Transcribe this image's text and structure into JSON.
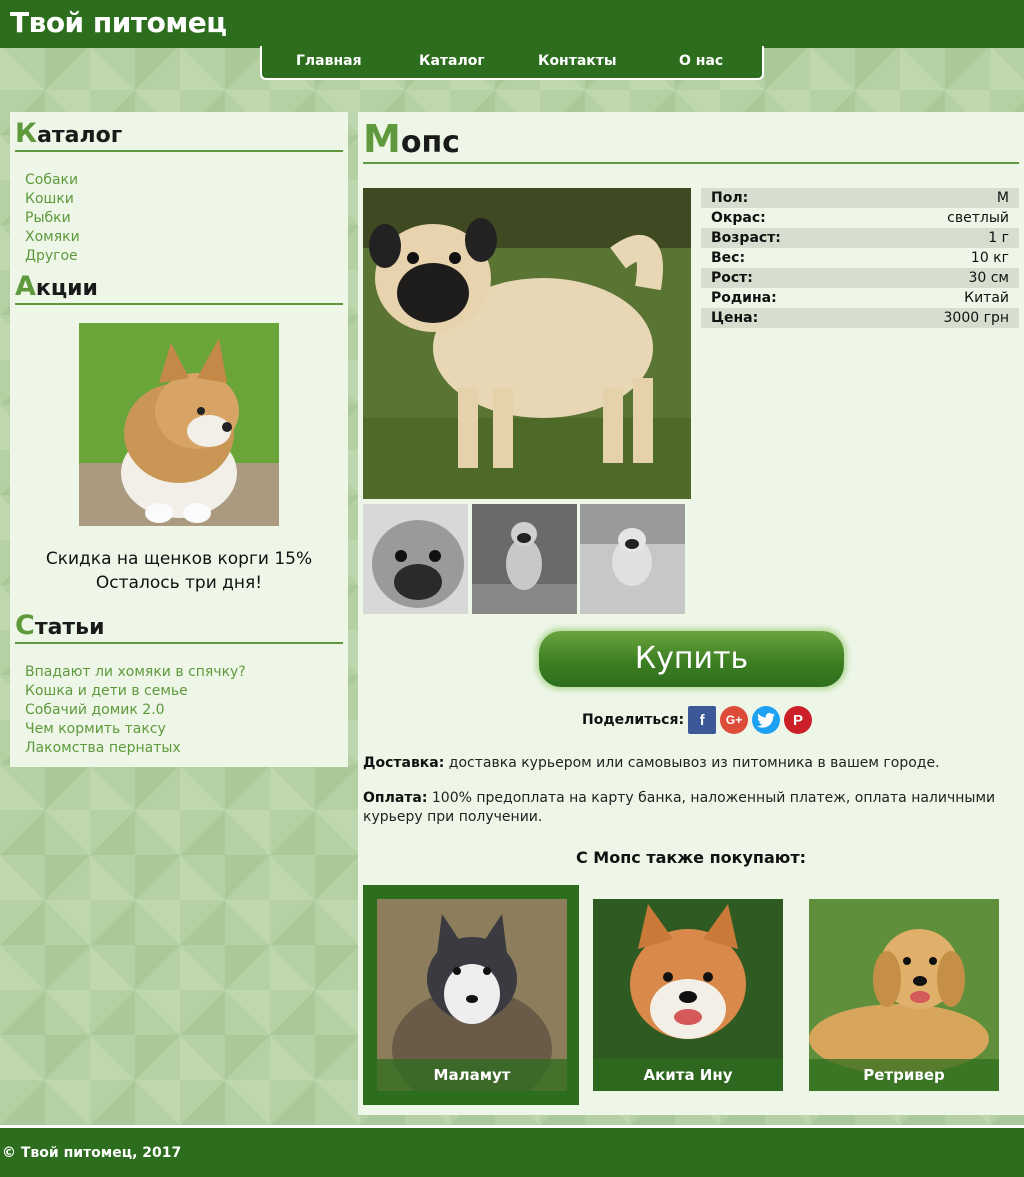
{
  "header": {
    "site_title": "Твой питомец",
    "nav": [
      "Главная",
      "Каталог",
      "Контакты",
      "О нас"
    ]
  },
  "sidebar": {
    "catalog": {
      "heading_first": "К",
      "heading_rest": "аталог",
      "items": [
        "Собаки",
        "Кошки",
        "Рыбки",
        "Хомяки",
        "Другое"
      ]
    },
    "promo": {
      "heading_first": "А",
      "heading_rest": "кции",
      "line1": "Скидка на щенков корги 15%",
      "line2": "Осталось три дня!"
    },
    "articles": {
      "heading_first": "С",
      "heading_rest": "татьи",
      "items": [
        "Впадают ли хомяки в спячку?",
        "Кошка и дети в семье",
        "Собачий домик 2.0",
        "Чем кормить таксу",
        "Лакомства пернатых"
      ]
    }
  },
  "product": {
    "title_first": "М",
    "title_rest": "опс",
    "specs": [
      {
        "label": "Пол:",
        "value": "М"
      },
      {
        "label": "Окрас:",
        "value": "светлый"
      },
      {
        "label": "Возраст:",
        "value": "1 г"
      },
      {
        "label": "Вес:",
        "value": "10 кг"
      },
      {
        "label": "Рост:",
        "value": "30 см"
      },
      {
        "label": "Родина:",
        "value": "Китай"
      },
      {
        "label": "Цена:",
        "value": "3000 грн"
      }
    ],
    "buy_label": "Купить",
    "share_label": "Поделиться:",
    "share_icons": [
      "facebook-icon",
      "google-plus-icon",
      "twitter-icon",
      "pinterest-icon"
    ],
    "delivery_label": "Доставка:",
    "delivery_text": " доставка курьером или самовывоз из питомника в вашем городе.",
    "payment_label": "Оплата:",
    "payment_text": " 100% предоплата на карту банка, наложенный платеж, оплата наличными курьеру при получении.",
    "also_heading": "С Мопс также покупают:",
    "recommendations": [
      "Маламут",
      "Акита Ину",
      "Ретривер"
    ]
  },
  "footer": {
    "copyright": "© Твой питомец, 2017"
  },
  "colors": {
    "brand_dark": "#2d6e1e",
    "accent": "#5e9a3c",
    "panel_bg": "#eef6e8",
    "facebook": "#3b5998",
    "google_plus": "#dd4b39",
    "twitter": "#1da1f2",
    "pinterest": "#cb2027"
  }
}
